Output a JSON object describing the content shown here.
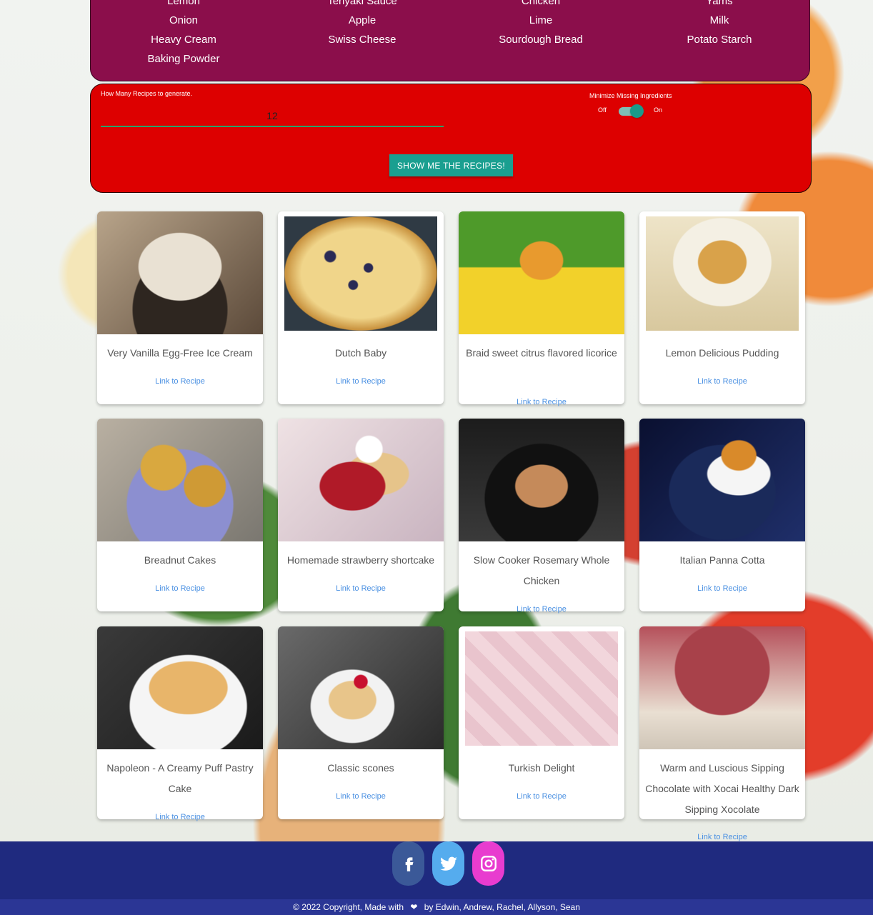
{
  "ingredients": {
    "columns": [
      [
        "Lemon",
        "Onion",
        "Heavy Cream",
        "Baking Powder"
      ],
      [
        "Teriyaki Sauce",
        "Apple",
        "Swiss Cheese"
      ],
      [
        "Chicken",
        "Lime",
        "Sourdough Bread"
      ],
      [
        "Yams",
        "Milk",
        "Potato Starch"
      ]
    ]
  },
  "controls": {
    "count_label": "How Many Recipes to generate.",
    "count_value": "12",
    "minimize_label": "Minimize Missing Ingredients",
    "toggle_off": "Off",
    "toggle_on": "On",
    "submit_label": "SHOW ME THE RECIPES!"
  },
  "recipes": [
    {
      "title": "Very Vanilla Egg-Free Ice Cream",
      "link": "Link to Recipe"
    },
    {
      "title": "Dutch Baby",
      "link": "Link to Recipe"
    },
    {
      "title": "Braid sweet citrus flavored licorice",
      "link": "Link to Recipe"
    },
    {
      "title": "Lemon Delicious Pudding",
      "link": "Link to Recipe"
    },
    {
      "title": "Breadnut Cakes",
      "link": "Link to Recipe"
    },
    {
      "title": "Homemade strawberry shortcake",
      "link": "Link to Recipe"
    },
    {
      "title": "Slow Cooker Rosemary Whole Chicken",
      "link": "Link to Recipe"
    },
    {
      "title": "Italian Panna Cotta",
      "link": "Link to Recipe"
    },
    {
      "title": "Napoleon - A Creamy Puff Pastry Cake",
      "link": "Link to Recipe"
    },
    {
      "title": "Classic scones",
      "link": "Link to Recipe"
    },
    {
      "title": "Turkish Delight",
      "link": "Link to Recipe"
    },
    {
      "title": "Warm and Luscious Sipping Chocolate with Xocai Healthy Dark Sipping Xocolate",
      "link": "Link to Recipe"
    }
  ],
  "footer": {
    "copyright_left": "© 2022 Copyright, Made with",
    "copyright_right": "by Edwin, Andrew, Rachel, Allyson, Sean",
    "social": [
      "facebook-icon",
      "twitter-icon",
      "instagram-icon"
    ]
  }
}
